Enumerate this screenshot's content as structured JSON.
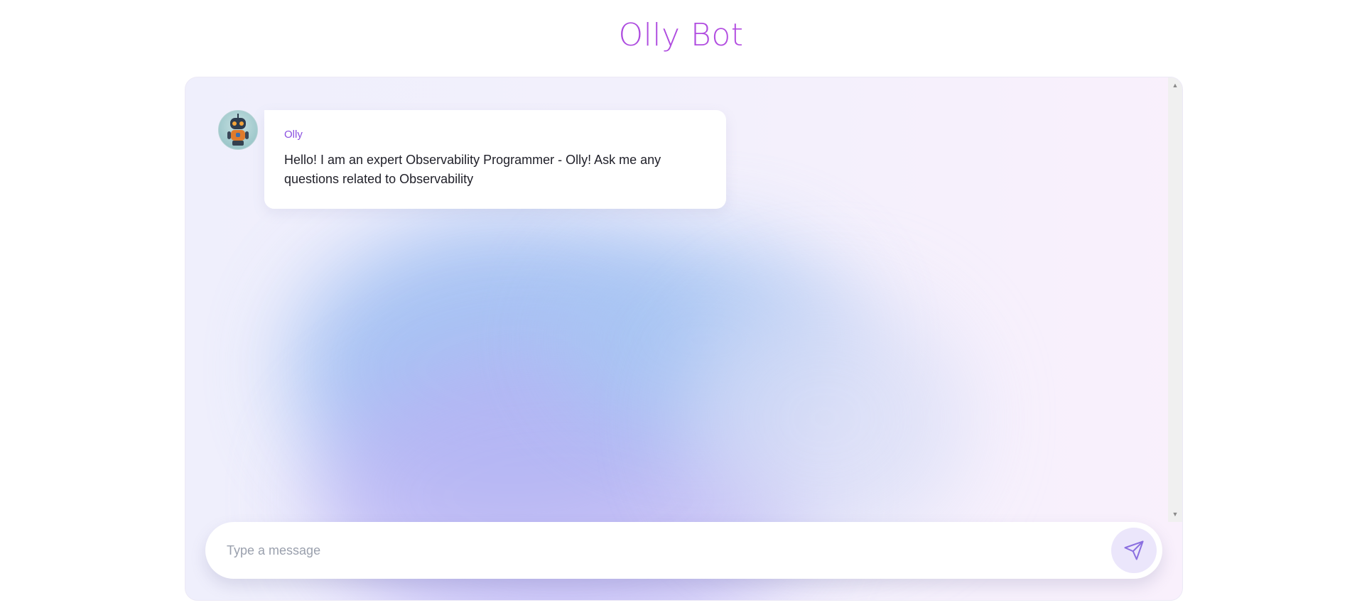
{
  "header": {
    "title": "Olly Bot"
  },
  "messages": [
    {
      "sender": "Olly",
      "text": "Hello! I am an expert Observability Programmer - Olly! Ask me any questions related to Observability",
      "avatar_icon": "robot-avatar"
    }
  ],
  "composer": {
    "placeholder": "Type a message",
    "value": "",
    "send_icon": "paper-plane-icon"
  },
  "colors": {
    "title_gradient_start": "#8b3fd9",
    "title_gradient_end": "#d46ad9",
    "sender_name": "#8a4fe0",
    "send_button_bg": "#ebe6fb",
    "send_icon": "#8b6fe0"
  }
}
